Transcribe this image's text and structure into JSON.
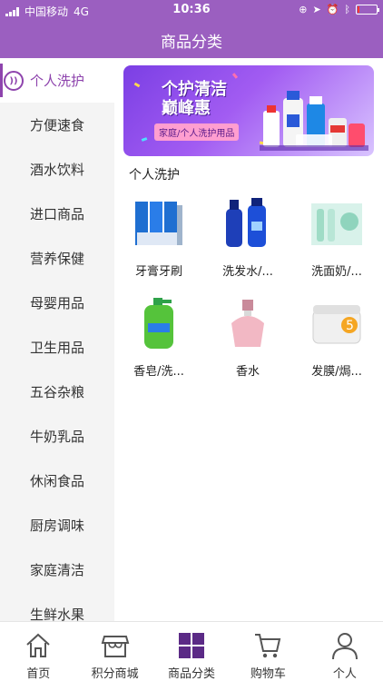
{
  "status_bar": {
    "carrier": "中国移动",
    "network": "4G",
    "time": "10:36",
    "battery_level": 0.12
  },
  "header": {
    "title": "商品分类"
  },
  "sidebar": {
    "active_index": 0,
    "items": [
      {
        "label": "个人洗护"
      },
      {
        "label": "方便速食"
      },
      {
        "label": "酒水饮料"
      },
      {
        "label": "进口商品"
      },
      {
        "label": "营养保健"
      },
      {
        "label": "母婴用品"
      },
      {
        "label": "卫生用品"
      },
      {
        "label": "五谷杂粮"
      },
      {
        "label": "牛奶乳品"
      },
      {
        "label": "休闲食品"
      },
      {
        "label": "厨房调味"
      },
      {
        "label": "家庭清洁"
      },
      {
        "label": "生鲜水果"
      }
    ]
  },
  "banner": {
    "title_line1": "个护清洁",
    "title_line2": "巅峰惠",
    "subtitle": "家庭/个人洗护用品"
  },
  "section": {
    "title": "个人洗护"
  },
  "products": [
    {
      "name": "牙膏牙刷",
      "icon": "toothpaste-icon"
    },
    {
      "name": "洗发水/...",
      "icon": "shampoo-icon"
    },
    {
      "name": "洗面奶/...",
      "icon": "facial-cleanser-icon"
    },
    {
      "name": "香皂/洗...",
      "icon": "soap-icon"
    },
    {
      "name": "香水",
      "icon": "perfume-icon"
    },
    {
      "name": "发膜/焗...",
      "icon": "hair-mask-icon"
    }
  ],
  "tabbar": {
    "active_index": 2,
    "tabs": [
      {
        "label": "首页",
        "icon": "home-icon"
      },
      {
        "label": "积分商城",
        "icon": "store-icon"
      },
      {
        "label": "商品分类",
        "icon": "category-icon"
      },
      {
        "label": "购物车",
        "icon": "cart-icon"
      },
      {
        "label": "个人",
        "icon": "user-icon"
      }
    ]
  },
  "colors": {
    "header": "#9b5fc0",
    "accent": "#8e44ad",
    "category_active": "#5b2a86"
  }
}
